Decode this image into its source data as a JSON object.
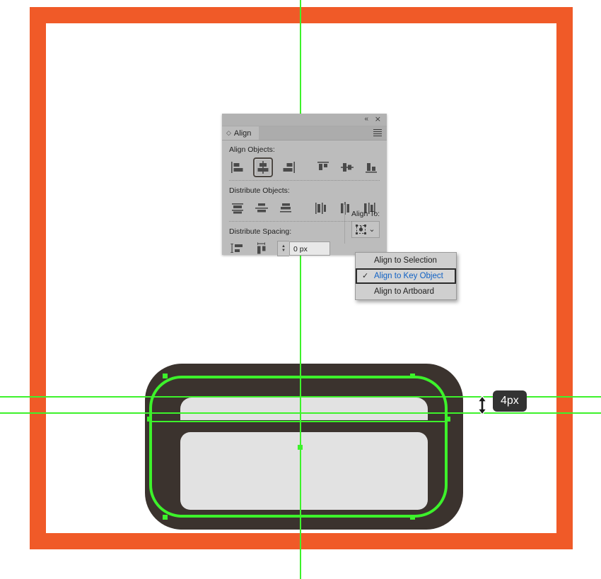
{
  "canvas": {
    "background_color": "#FFFFFF",
    "artboard_frame_color": "#F05A28",
    "artwork": {
      "body_color": "#3B332E",
      "screen_color": "#E2E2E2"
    },
    "guide_color": "#3DF22B",
    "selection_color": "#3DF22B"
  },
  "panel": {
    "title": "Align",
    "tab_icon": "diamond-icon",
    "collapse_icon": "«",
    "close_icon": "×",
    "menu_icon": "hamburger-menu-icon",
    "sections": {
      "align_objects": {
        "label": "Align Objects:",
        "buttons": [
          {
            "name": "horizontal-align-left",
            "selected": false
          },
          {
            "name": "horizontal-align-center",
            "selected": true
          },
          {
            "name": "horizontal-align-right",
            "selected": false
          },
          {
            "name": "vertical-align-top",
            "selected": false
          },
          {
            "name": "vertical-align-center",
            "selected": false
          },
          {
            "name": "vertical-align-bottom",
            "selected": false
          }
        ]
      },
      "distribute_objects": {
        "label": "Distribute Objects:",
        "buttons": [
          {
            "name": "vertical-distribute-top",
            "selected": false
          },
          {
            "name": "vertical-distribute-center",
            "selected": false
          },
          {
            "name": "vertical-distribute-bottom",
            "selected": false
          },
          {
            "name": "horizontal-distribute-left",
            "selected": false
          },
          {
            "name": "horizontal-distribute-center",
            "selected": false
          },
          {
            "name": "horizontal-distribute-right",
            "selected": false
          }
        ]
      },
      "distribute_spacing": {
        "label": "Distribute Spacing:",
        "buttons": [
          {
            "name": "vertical-distribute-spacing",
            "selected": false
          },
          {
            "name": "horizontal-distribute-spacing",
            "selected": false
          }
        ],
        "input_value": "0 px",
        "input_placeholder": "0 px"
      },
      "align_to": {
        "label": "Align To:",
        "button_icon": "align-to-key-object-icon",
        "chevron": "⌄"
      }
    }
  },
  "dropdown": {
    "items": [
      {
        "label": "Align to Selection",
        "checked": false
      },
      {
        "label": "Align to Key Object",
        "checked": true
      },
      {
        "label": "Align to Artboard",
        "checked": false
      }
    ],
    "check_glyph": "✓",
    "highlight_text_color": "#1061C4"
  },
  "measurement": {
    "value": "4px",
    "cursor_icon": "vertical-resize-cursor",
    "tooltip_bg": "#333333",
    "tooltip_fg": "#FFFFFF"
  }
}
